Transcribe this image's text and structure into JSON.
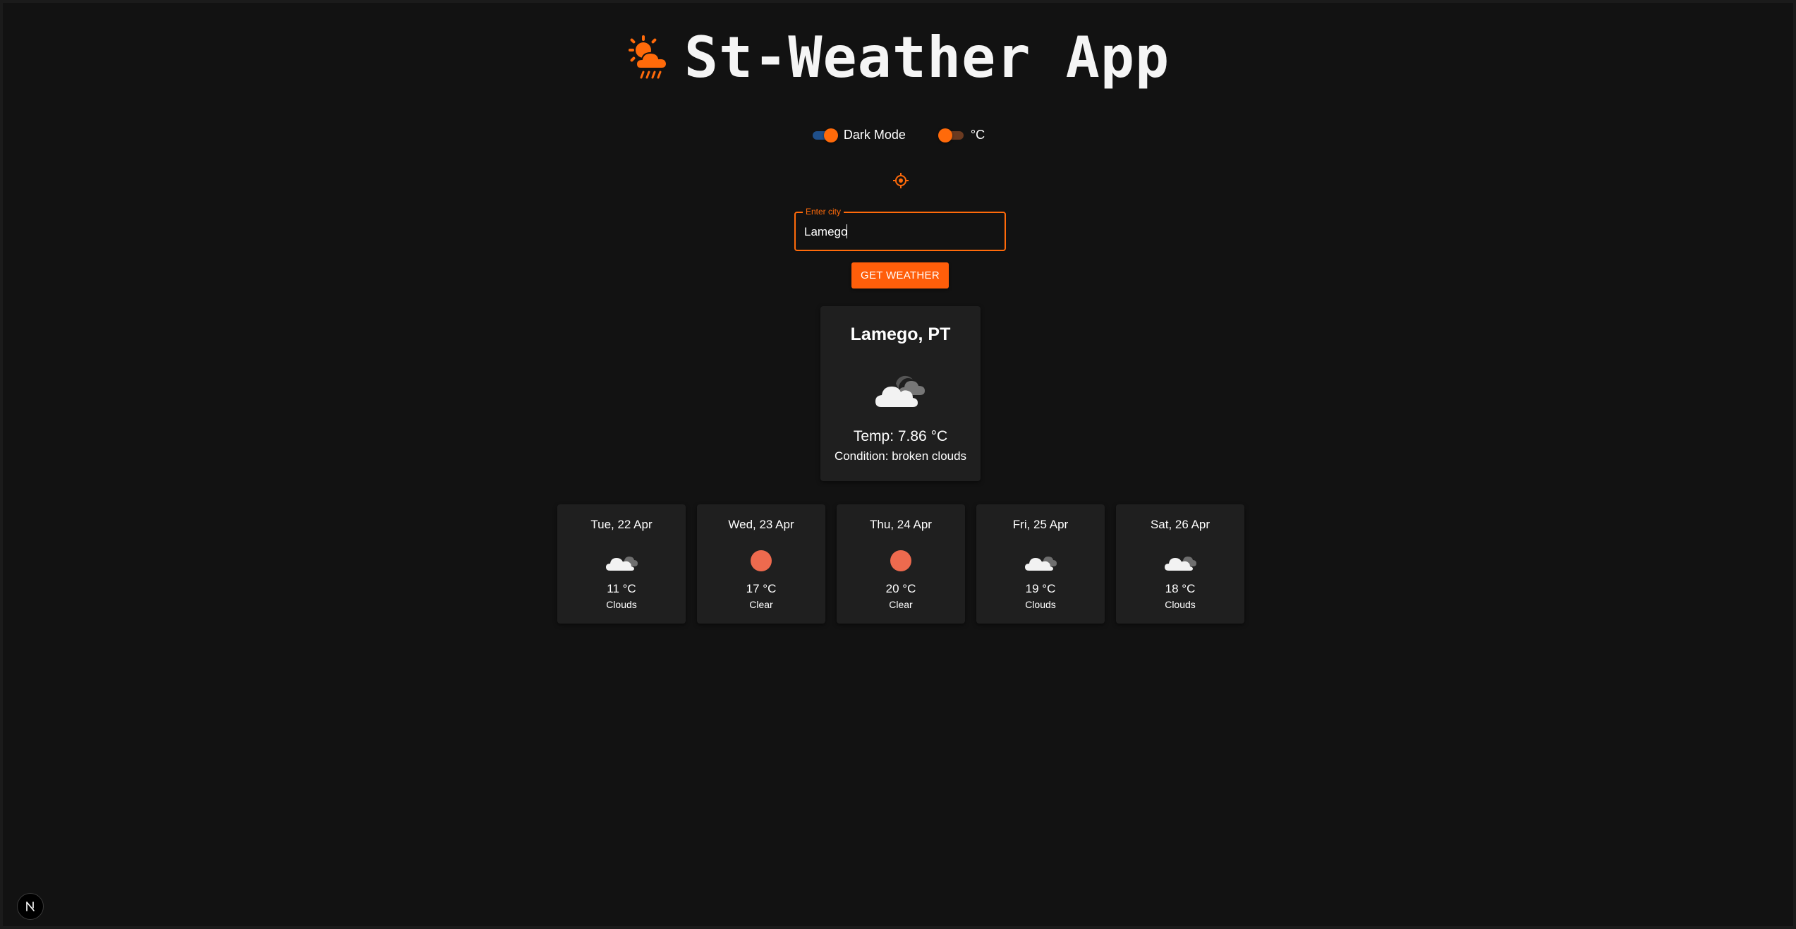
{
  "app": {
    "title": "St-Weather App",
    "logo_icon": "sun-cloud-rain-icon",
    "accent_color": "#ff6a0a"
  },
  "toggles": {
    "dark_mode_label": "Dark Mode",
    "dark_mode_on": true,
    "unit_label": "°C",
    "unit_fahrenheit": false
  },
  "search": {
    "label": "Enter city",
    "value": "Lamego",
    "button_label": "GET WEATHER",
    "locate_icon": "crosshair-location-icon"
  },
  "current": {
    "city": "Lamego, PT",
    "icon": "broken-clouds-icon",
    "temp_text": "Temp: 7.86 °C",
    "condition_text": "Condition: broken clouds"
  },
  "forecast": [
    {
      "date": "Tue, 22 Apr",
      "temp": "11 °C",
      "condition": "Clouds",
      "icon": "clouds-icon"
    },
    {
      "date": "Wed, 23 Apr",
      "temp": "17 °C",
      "condition": "Clear",
      "icon": "clear-sun-icon"
    },
    {
      "date": "Thu, 24 Apr",
      "temp": "20 °C",
      "condition": "Clear",
      "icon": "clear-sun-icon"
    },
    {
      "date": "Fri, 25 Apr",
      "temp": "19 °C",
      "condition": "Clouds",
      "icon": "clouds-icon"
    },
    {
      "date": "Sat, 26 Apr",
      "temp": "18 °C",
      "condition": "Clouds",
      "icon": "clouds-icon"
    }
  ],
  "dev_badge": {
    "text": "N",
    "icon": "nextjs-dev-icon"
  }
}
